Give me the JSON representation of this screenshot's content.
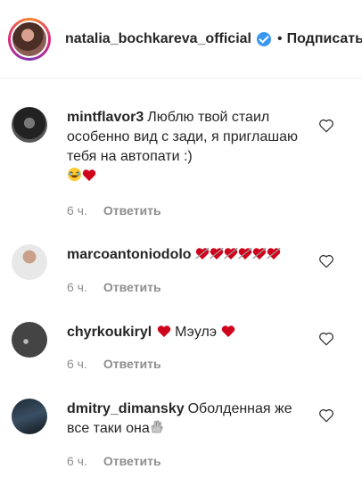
{
  "header": {
    "username": "natalia_bochkareva_official",
    "dot": "•",
    "follow_label": "Подписаться"
  },
  "comments": [
    {
      "username": "mintflavor3",
      "text": "Люблю твой стаил особенно вид с зади, я приглашаю тебя на автопати :)",
      "time": "6 ч.",
      "reply": "Ответить"
    },
    {
      "username": "marcoantoniodolo",
      "text": "",
      "time": "6 ч.",
      "reply": "Ответить"
    },
    {
      "username": "chyrkoukiryl",
      "text": "Мэулэ",
      "time": "6 ч.",
      "reply": "Ответить"
    },
    {
      "username": "dmitry_dimansky",
      "text": "Оболденная же все таки она",
      "time": "6 ч.",
      "reply": "Ответить"
    }
  ],
  "colors": {
    "heart_red": "#d0021b",
    "verified_blue": "#3897f0",
    "meta_gray": "#8e8e8e"
  },
  "icons": [
    "verified-badge-icon",
    "like-heart-icon",
    "red-heart-emoji",
    "heart-with-arrow-emoji",
    "laughing-emoji",
    "waving-hand-emoji"
  ]
}
